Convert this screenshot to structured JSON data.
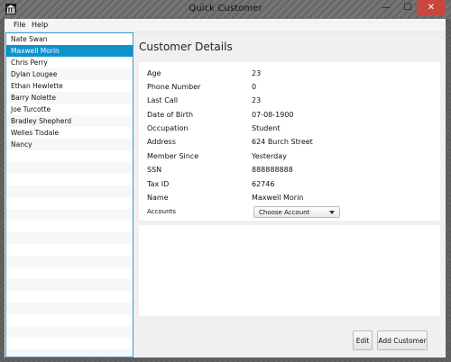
{
  "window": {
    "title": "Quick Customer"
  },
  "title_buttons": {
    "minimize": "—",
    "maximize": "☐",
    "close": "✕"
  },
  "menu": {
    "file": "File",
    "help": "Help"
  },
  "customers": [
    {
      "name": "Nate Swan",
      "selected": false
    },
    {
      "name": "Maxwell Morin",
      "selected": true
    },
    {
      "name": "Chris Perry",
      "selected": false
    },
    {
      "name": "Dylan Lougee",
      "selected": false
    },
    {
      "name": "Ethan Hewlette",
      "selected": false
    },
    {
      "name": "Barry Nolette",
      "selected": false
    },
    {
      "name": "Joe Turcotte",
      "selected": false
    },
    {
      "name": "Bradley Shepherd",
      "selected": false
    },
    {
      "name": "Welles Tisdale",
      "selected": false
    },
    {
      "name": "Nancy",
      "selected": false
    }
  ],
  "details": {
    "heading": "Customer Details",
    "fields": [
      {
        "label": "Age",
        "value": "23"
      },
      {
        "label": "Phone Number",
        "value": "0"
      },
      {
        "label": "Last Call",
        "value": "23"
      },
      {
        "label": "Date of Birth",
        "value": "07-08-1900"
      },
      {
        "label": "Occupation",
        "value": "Student"
      },
      {
        "label": "Address",
        "value": "624 Burch Street"
      },
      {
        "label": "Member Since",
        "value": "Yesterday"
      },
      {
        "label": "SSN",
        "value": "888888888"
      },
      {
        "label": "Tax ID",
        "value": "62746"
      },
      {
        "label": "Name",
        "value": "Maxwell Morin"
      }
    ],
    "accounts_label": "Accounts",
    "accounts_select": "Choose Account"
  },
  "buttons": {
    "edit": "Edit",
    "add_customer": "Add Customer"
  },
  "colors": {
    "selection": "#0f91cc",
    "close_button": "#c7463e",
    "list_border": "#3d9bd4"
  },
  "icons": {
    "app": "bank-icon",
    "dropdown": "chevron-down-icon"
  }
}
